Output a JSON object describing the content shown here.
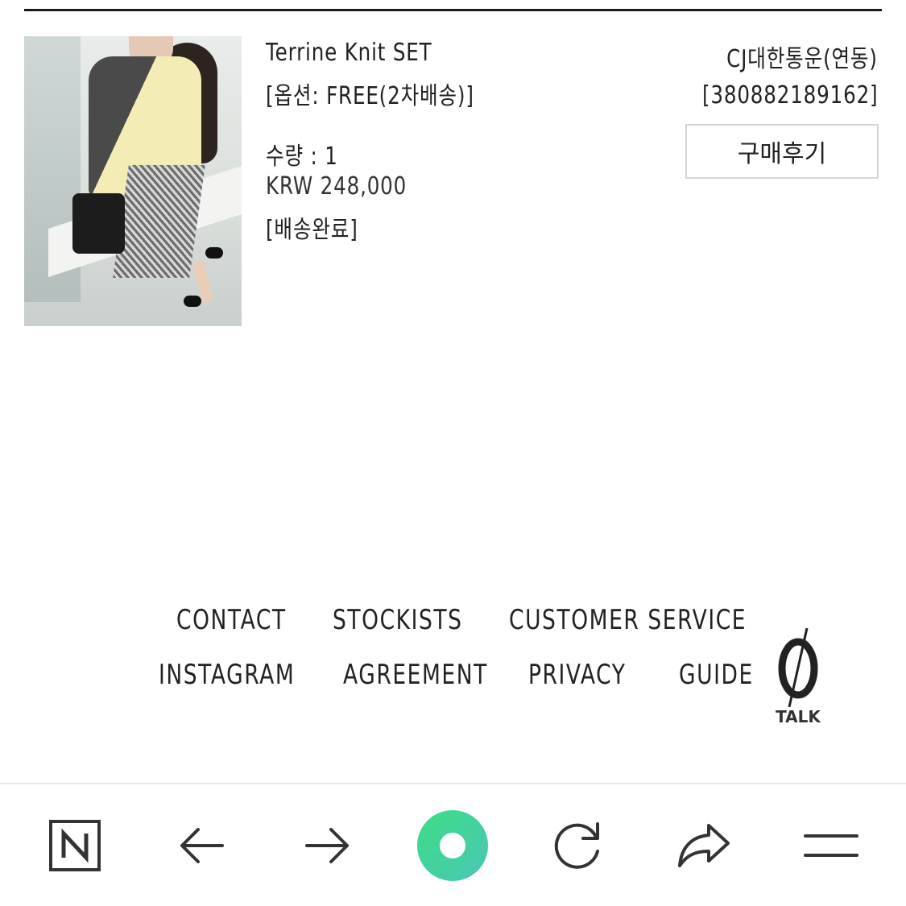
{
  "order": {
    "product_name": "Terrine Knit SET",
    "option": "[옵션: FREE(2차배송)]",
    "quantity": "수량 : 1",
    "price": "KRW 248,000",
    "status": "[배송완료]",
    "carrier": "CJ대한통운(연동)",
    "tracking_number": "[380882189162]",
    "review_button_label": "구매후기"
  },
  "footer": {
    "links": [
      "CONTACT",
      "STOCKISTS",
      "CUSTOMER SERVICE",
      "INSTAGRAM",
      "AGREEMENT",
      "PRIVACY",
      "GUIDE"
    ],
    "talk_label": "TALK"
  },
  "browser_bar": {
    "icons": [
      "naver-home-icon",
      "back-arrow-icon",
      "forward-arrow-icon",
      "green-circle-icon",
      "refresh-icon",
      "share-icon",
      "menu-icon"
    ],
    "accent_color": "#3ddc84"
  }
}
